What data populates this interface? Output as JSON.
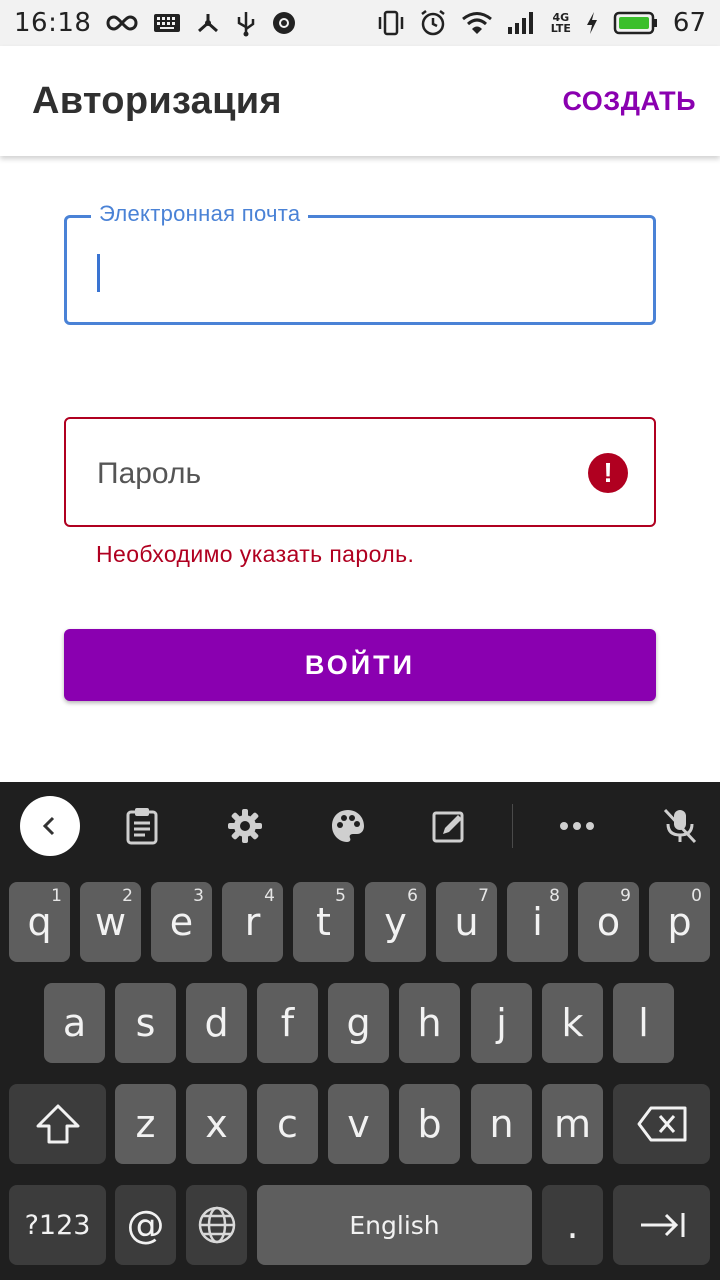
{
  "status_bar": {
    "time": "16:18",
    "battery_percent": "67",
    "network": [
      "4G",
      "LTE"
    ],
    "left_icons": [
      "infinity-icon",
      "keyboard-icon",
      "share-network-icon",
      "usb-icon",
      "chrome-icon"
    ],
    "right_icons": [
      "vibrate-icon",
      "alarm-icon",
      "wifi-icon",
      "signal-icon",
      "charging-icon",
      "battery-icon"
    ]
  },
  "app_bar": {
    "title": "Авторизация",
    "create_label": "СОЗДАТЬ",
    "accent_color": "#8a00b0"
  },
  "form": {
    "email_label": "Электронная почта",
    "email_value": "",
    "password_placeholder": "Пароль",
    "password_error": "Необходимо указать пароль.",
    "login_label": "ВОЙТИ",
    "error_color": "#b00020",
    "focus_color": "#4a82d6"
  },
  "keyboard": {
    "toolbar": [
      "back-icon",
      "clipboard-icon",
      "gear-icon",
      "palette-icon",
      "edit-mode-icon",
      "more-icon",
      "mic-off-icon"
    ],
    "row1": [
      {
        "key": "q",
        "hint": "1"
      },
      {
        "key": "w",
        "hint": "2"
      },
      {
        "key": "e",
        "hint": "3"
      },
      {
        "key": "r",
        "hint": "4"
      },
      {
        "key": "t",
        "hint": "5"
      },
      {
        "key": "y",
        "hint": "6"
      },
      {
        "key": "u",
        "hint": "7"
      },
      {
        "key": "i",
        "hint": "8"
      },
      {
        "key": "o",
        "hint": "9"
      },
      {
        "key": "p",
        "hint": "0"
      }
    ],
    "row2": [
      "a",
      "s",
      "d",
      "f",
      "g",
      "h",
      "j",
      "k",
      "l"
    ],
    "row3": [
      "z",
      "x",
      "c",
      "v",
      "b",
      "n",
      "m"
    ],
    "symbols_label": "?123",
    "at_label": "@",
    "space_label": "English",
    "period_label": "."
  }
}
